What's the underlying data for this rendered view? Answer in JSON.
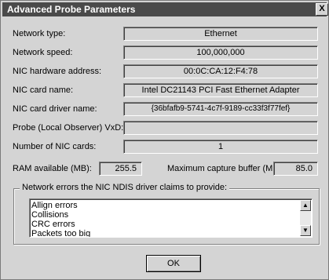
{
  "title": "Advanced Probe Parameters",
  "close_glyph": "X",
  "rows": [
    {
      "label": "Network type:",
      "value": "Ethernet"
    },
    {
      "label": "Network speed:",
      "value": "100,000,000"
    },
    {
      "label": "NIC hardware address:",
      "value": "00:0C:CA:12:F4:78"
    },
    {
      "label": "NIC card name:",
      "value": "Intel DC21143 PCI Fast Ethernet Adapter"
    },
    {
      "label": "NIC card driver name:",
      "value": "{36bfafb9-5741-4c7f-9189-cc33f3f77fef}"
    },
    {
      "label": "Probe (Local Observer) VxD:",
      "value": ""
    },
    {
      "label": "Number of NIC cards:",
      "value": "1"
    }
  ],
  "ram": {
    "label": "RAM available (MB):",
    "value": "255.5"
  },
  "capture": {
    "label": "Maximum capture buffer (MB):",
    "value": "85.0"
  },
  "errors_group": {
    "label": "Network errors the NIC NDIS driver claims to provide:",
    "items": [
      "Allign errors",
      "Collisions",
      "CRC errors",
      "Packets too big"
    ]
  },
  "ok_label": "OK"
}
